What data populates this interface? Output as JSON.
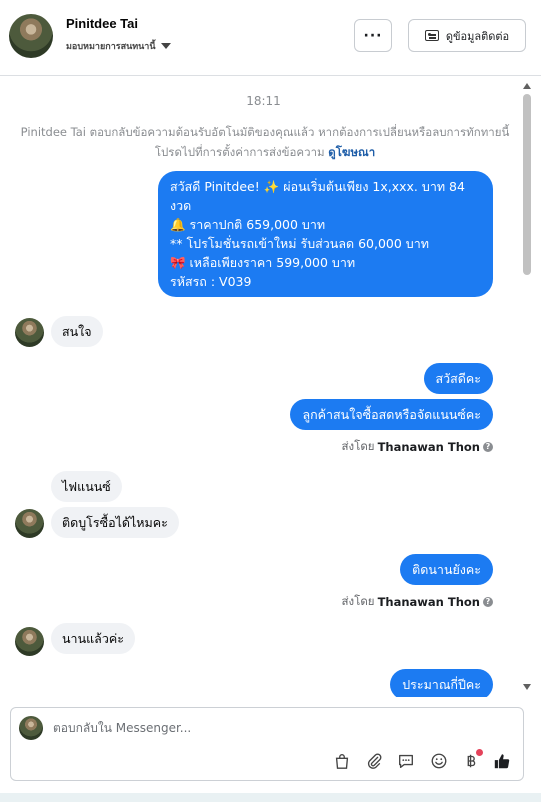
{
  "header": {
    "contact_name": "Pinitdee Tai",
    "assign_label": "มอบหมายการสนทนานี้",
    "more_label": "···",
    "contact_info_label": "ดูข้อมูลติดต่อ"
  },
  "conversation": {
    "timestamp": "18:11",
    "system_note": "Pinitdee Tai ตอบกลับข้อความต้อนรับอัตโนมัติของคุณแล้ว หากต้องการเปลี่ยนหรือลบการทักทายนี้ โปรดไปที่การตั้งค่าการส่งข้อความ",
    "system_note_link": "ดูโฆษณา",
    "ad_message": {
      "line1": "สวัสดี Pinitdee! ✨  ผ่อนเริ่มต้นเพียง 1x,xxx. บาท 84 งวด",
      "line2": "🔔 ราคาปกติ 659,000 บาท",
      "line3": "** โปรโมชั่นรถเข้าใหม่ รับส่วนลด 60,000 บาท",
      "line4": "🎀  เหลือเพียงราคา 599,000 บาท",
      "line5": " รหัสรถ : V039"
    },
    "msg_in_1": "สนใจ",
    "msg_out_1": "สวัสดีคะ",
    "msg_out_2": "ลูกค้าสนใจซื้อสดหรือจัดแนนซ์คะ",
    "sent_by_prefix": "ส่งโดย",
    "sent_by_name": "Thanawan Thon",
    "msg_in_2": "ไฟแนนซ์",
    "msg_in_3": "ติดบูโรซื้อได้ไหมคะ",
    "msg_out_3": "ติดนานยังคะ",
    "msg_in_4": "นานแล้วค่ะ",
    "msg_out_4": "ประมาณกี่ปีคะ"
  },
  "composer": {
    "placeholder": "ตอบกลับใน Messenger..."
  },
  "colors": {
    "outgoing_bubble": "#1c7bf2",
    "incoming_bubble": "#f0f2f5",
    "link": "#1f5ea8",
    "notification_dot": "#e4425a"
  },
  "icons": [
    "chevron-down-icon",
    "contact-card-icon",
    "shopping-bag-icon",
    "paperclip-icon",
    "saved-replies-icon",
    "emoji-icon",
    "baht-payment-icon",
    "thumbs-up-icon",
    "help-icon"
  ]
}
